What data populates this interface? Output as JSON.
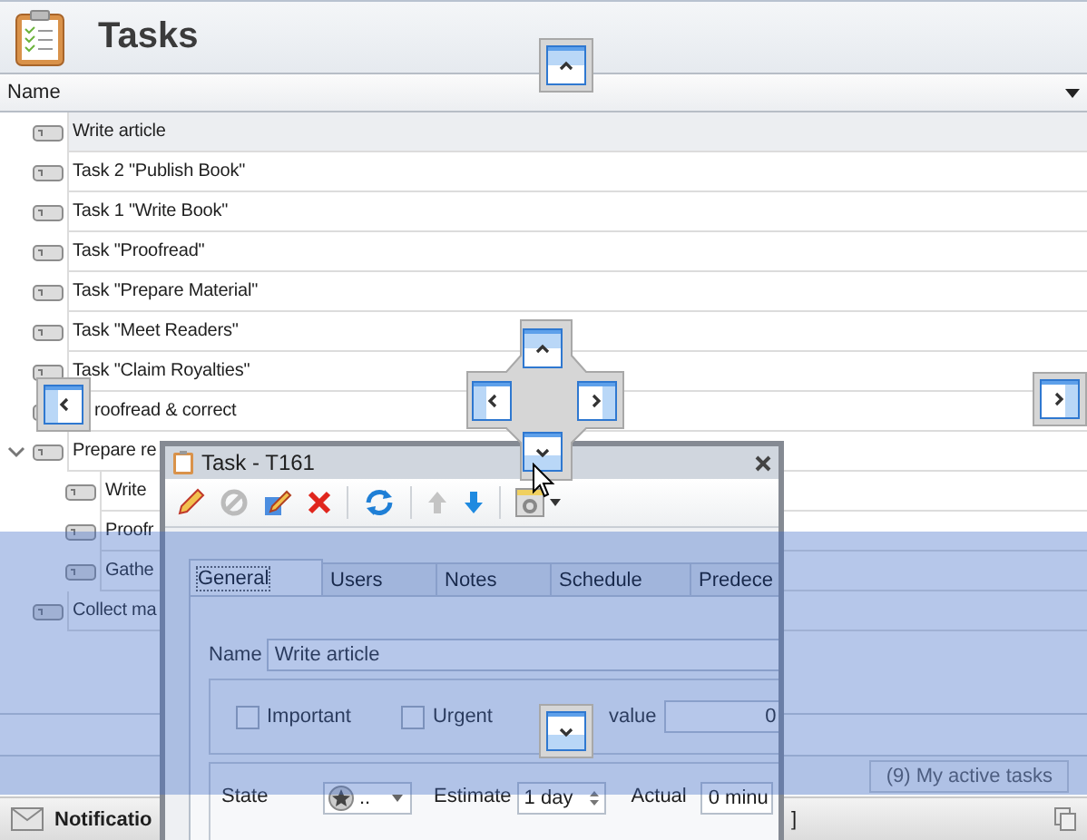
{
  "header": {
    "title": "Tasks"
  },
  "grid": {
    "column": "Name",
    "rows": [
      {
        "label": "Write article",
        "selected": true
      },
      {
        "label": "Task 2 \"Publish Book\"",
        "selected": false
      },
      {
        "label": "Task 1 \"Write Book\"",
        "selected": false
      },
      {
        "label": "Task \"Proofread\"",
        "selected": false
      },
      {
        "label": "Task \"Prepare Material\"",
        "selected": false
      },
      {
        "label": "Task \"Meet Readers\"",
        "selected": false
      },
      {
        "label": "Task \"Claim Royalties\"",
        "selected": false
      },
      {
        "label": "roofread & correct",
        "selected": false
      },
      {
        "label": "Prepare re",
        "selected": false,
        "expanded": true,
        "children": [
          {
            "label": "Write",
            "selected": false
          },
          {
            "label": "Proofr",
            "selected": false
          },
          {
            "label": "Gathe",
            "selected": false
          }
        ]
      },
      {
        "label": "Collect ma",
        "selected": false
      }
    ]
  },
  "footer": {
    "button": "(9) My active tasks"
  },
  "status_bar": {
    "notification": "Notificatio",
    "tail": "]"
  },
  "task_window": {
    "title": "Task - T161",
    "tabs": [
      {
        "label": "General",
        "selected": true
      },
      {
        "label": "Users",
        "selected": false
      },
      {
        "label": "Notes",
        "selected": false
      },
      {
        "label": "Schedule",
        "selected": false
      },
      {
        "label": "Predece",
        "selected": false
      }
    ],
    "name_label": "Name",
    "name_value": "Write article",
    "checkboxes": [
      {
        "label": "Important",
        "checked": false
      },
      {
        "label": "Urgent",
        "checked": false
      }
    ],
    "value_label": "value",
    "value": "0",
    "state_label": "State",
    "state_value": "..",
    "estimate_label": "Estimate",
    "estimate_value": "1 day",
    "actual_label": "Actual",
    "actual_value": "0 minu"
  }
}
